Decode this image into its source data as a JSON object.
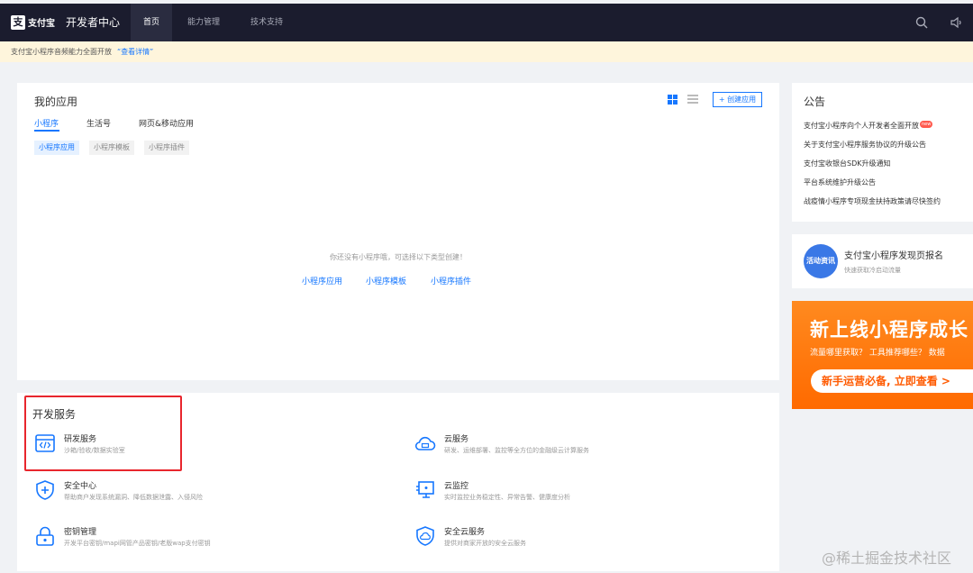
{
  "nav": {
    "logo_mark": "支",
    "logo_text": "支付宝",
    "title": "开发者中心",
    "items": [
      "首页",
      "能力管理",
      "技术支持"
    ],
    "search_icon": "search-icon",
    "sound_icon": "speaker-icon"
  },
  "banner": {
    "text": "支付宝小程序音频能力全面开放",
    "link": "“查看详情”"
  },
  "apps": {
    "title": "我的应用",
    "create_label": "+ 创建应用",
    "tabs": [
      "小程序",
      "生活号",
      "网页&移动应用"
    ],
    "chips": [
      "小程序应用",
      "小程序模板",
      "小程序插件"
    ],
    "empty_text": "你还没有小程序哦，可选择以下类型创建！",
    "empty_links": [
      "小程序应用",
      "小程序模板",
      "小程序插件"
    ]
  },
  "services": {
    "title": "开发服务",
    "items": [
      {
        "name": "研发服务",
        "desc": "沙箱/验收/数据实验室",
        "icon": "code-window-icon"
      },
      {
        "name": "云服务",
        "desc": "研发、运维部署、监控等全方位的金融级云计算服务",
        "icon": "cloud-icon"
      },
      {
        "name": "安全中心",
        "desc": "帮助商户发现系统漏洞、降低数据泄露、入侵风险",
        "icon": "shield-plus-icon"
      },
      {
        "name": "云监控",
        "desc": "实时监控业务稳定性、异常告警、健康度分析",
        "icon": "monitor-icon"
      },
      {
        "name": "密钥管理",
        "desc": "开发平台密钥/mapi网管产品密钥/老版wap支付密钥",
        "icon": "lock-icon"
      },
      {
        "name": "安全云服务",
        "desc": "提供对商家开放的安全云服务",
        "icon": "cloud-shield-icon"
      }
    ]
  },
  "notice": {
    "title": "公告",
    "new_badge": "new",
    "items": [
      "支付宝小程序向个人开发者全面开放",
      "关于支付宝小程序服务协议的升级公告",
      "支付宝收银台SDK升级通知",
      "平台系统维护升级公告",
      "战疫情小程序专项现金扶持政策请尽快签约"
    ]
  },
  "discover": {
    "avatar_text": "活动资讯",
    "title": "支付宝小程序发现页报名",
    "sub": "快速获取冷启动流量"
  },
  "promo": {
    "title": "新上线小程序成长",
    "sub": "流量哪里获取？ 工具推荐哪些？ 数据",
    "button": "新手运营必备, 立即查看 >"
  },
  "watermark": "@稀土掘金技术社区",
  "colors": {
    "nav_bg": "#1b1c2e",
    "accent": "#1677ff",
    "highlight": "#e8262d",
    "promo": "#ff7a10"
  }
}
